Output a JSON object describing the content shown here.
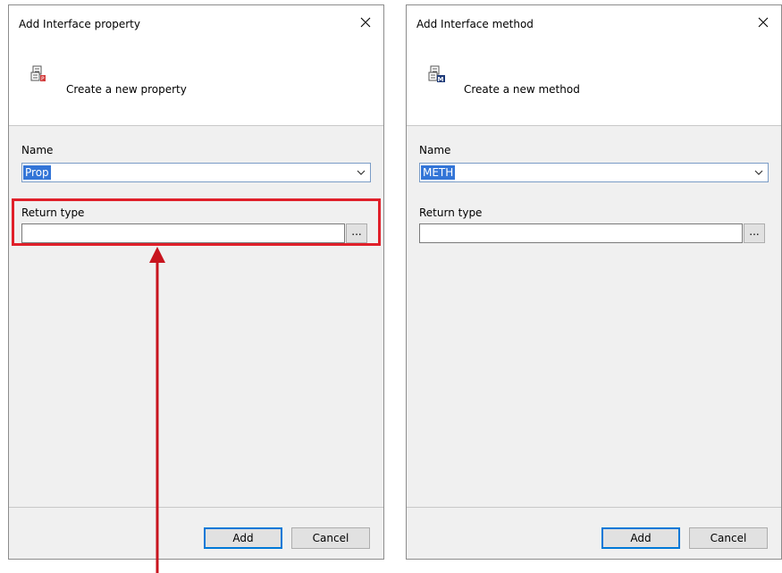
{
  "left_dialog": {
    "title": "Add Interface property",
    "subtitle": "Create a new property",
    "header_icon": "property-icon",
    "name_label": "Name",
    "name_value": "Prop",
    "return_type_label": "Return type",
    "return_type_value": "",
    "browse_label": "...",
    "add_label": "Add",
    "cancel_label": "Cancel"
  },
  "right_dialog": {
    "title": "Add Interface method",
    "subtitle": "Create a new method",
    "header_icon": "method-icon",
    "name_label": "Name",
    "name_value": "METH",
    "return_type_label": "Return type",
    "return_type_value": "",
    "browse_label": "...",
    "add_label": "Add",
    "cancel_label": "Cancel"
  },
  "annotation": {
    "highlight_color": "#e0202a",
    "arrow_color": "#c8141e"
  },
  "colors": {
    "selection": "#3375d7",
    "focus_border": "#0078d7",
    "panel_bg": "#f0f0f0"
  }
}
